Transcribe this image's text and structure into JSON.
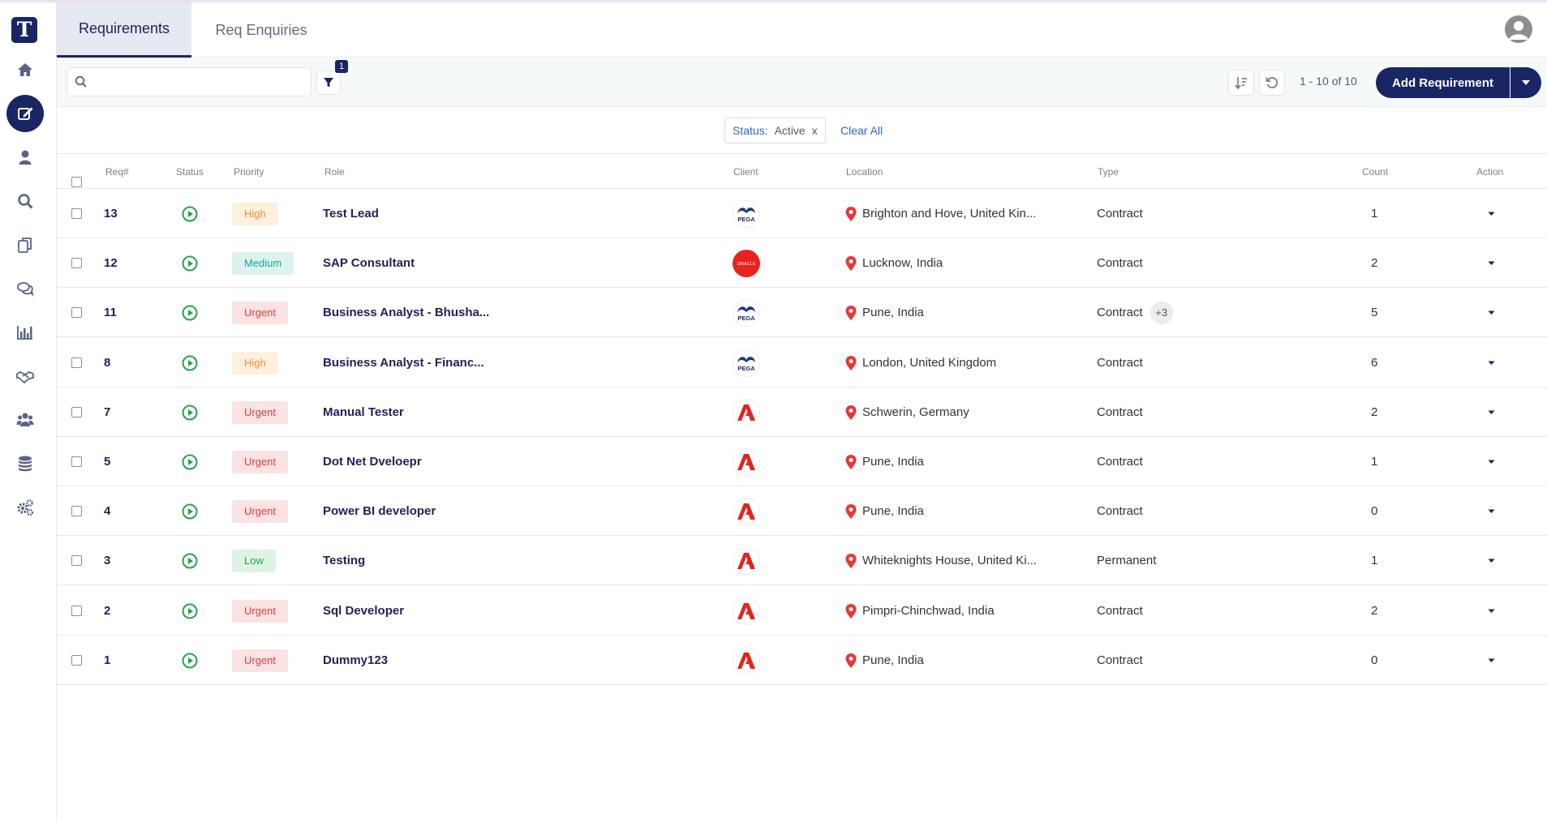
{
  "app": {
    "logo_letter": "T"
  },
  "sidebar": {
    "items": [
      {
        "name": "home-icon",
        "active": false
      },
      {
        "name": "edit-icon",
        "active": true
      },
      {
        "name": "person-icon",
        "active": false
      },
      {
        "name": "search-icon",
        "active": false
      },
      {
        "name": "documents-icon",
        "active": false
      },
      {
        "name": "chat-icon",
        "active": false
      },
      {
        "name": "bar-chart-icon",
        "active": false
      },
      {
        "name": "handshake-icon",
        "active": false
      },
      {
        "name": "users-icon",
        "active": false
      },
      {
        "name": "database-icon",
        "active": false
      },
      {
        "name": "gears-icon",
        "active": false
      }
    ]
  },
  "tabs": [
    {
      "label": "Requirements",
      "active": true
    },
    {
      "label": "Req Enquiries",
      "active": false
    }
  ],
  "toolbar": {
    "search_placeholder": "",
    "filter_count": "1",
    "pager": "1 - 10 of 10",
    "add_label": "Add Requirement"
  },
  "filters": {
    "chip_key": "Status:",
    "chip_value": "Active",
    "chip_remove": "x",
    "clear_all": "Clear All"
  },
  "table": {
    "headers": {
      "req": "Req#",
      "status": "Status",
      "priority": "Priority",
      "role": "Role",
      "client": "Client",
      "location": "Location",
      "type": "Type",
      "count": "Count",
      "action": "Action"
    },
    "rows": [
      {
        "req": "13",
        "priority": "High",
        "role": "Test Lead",
        "client": "pega",
        "location": "Brighton and Hove, United Kin...",
        "type": "Contract",
        "extra": "",
        "count": "1"
      },
      {
        "req": "12",
        "priority": "Medium",
        "role": "SAP Consultant",
        "client": "oracle",
        "location": "Lucknow, India",
        "type": "Contract",
        "extra": "",
        "count": "2"
      },
      {
        "req": "11",
        "priority": "Urgent",
        "role": "Business Analyst - Bhusha...",
        "client": "pega",
        "location": "Pune, India",
        "type": "Contract",
        "extra": "+3",
        "count": "5"
      },
      {
        "req": "8",
        "priority": "High",
        "role": "Business Analyst - Financ...",
        "client": "pega",
        "location": "London, United Kingdom",
        "type": "Contract",
        "extra": "",
        "count": "6"
      },
      {
        "req": "7",
        "priority": "Urgent",
        "role": "Manual Tester",
        "client": "adobe",
        "location": "Schwerin, Germany",
        "type": "Contract",
        "extra": "",
        "count": "2"
      },
      {
        "req": "5",
        "priority": "Urgent",
        "role": "Dot Net Dveloepr",
        "client": "adobe",
        "location": "Pune, India",
        "type": "Contract",
        "extra": "",
        "count": "1"
      },
      {
        "req": "4",
        "priority": "Urgent",
        "role": "Power BI developer",
        "client": "adobe",
        "location": "Pune, India",
        "type": "Contract",
        "extra": "",
        "count": "0"
      },
      {
        "req": "3",
        "priority": "Low",
        "role": "Testing",
        "client": "adobe",
        "location": "Whiteknights House, United Ki...",
        "type": "Permanent",
        "extra": "",
        "count": "1"
      },
      {
        "req": "2",
        "priority": "Urgent",
        "role": "Sql Developer",
        "client": "adobe",
        "location": "Pimpri-Chinchwad, India",
        "type": "Contract",
        "extra": "",
        "count": "2"
      },
      {
        "req": "1",
        "priority": "Urgent",
        "role": "Dummy123",
        "client": "adobe",
        "location": "Pune, India",
        "type": "Contract",
        "extra": "",
        "count": "0"
      }
    ]
  },
  "client_logos": {
    "pega_text": "PEGA",
    "oracle_text": "ORACLE"
  },
  "colors": {
    "brand": "#1a2563",
    "status_active": "#27a14e",
    "pin": "#e53935"
  }
}
